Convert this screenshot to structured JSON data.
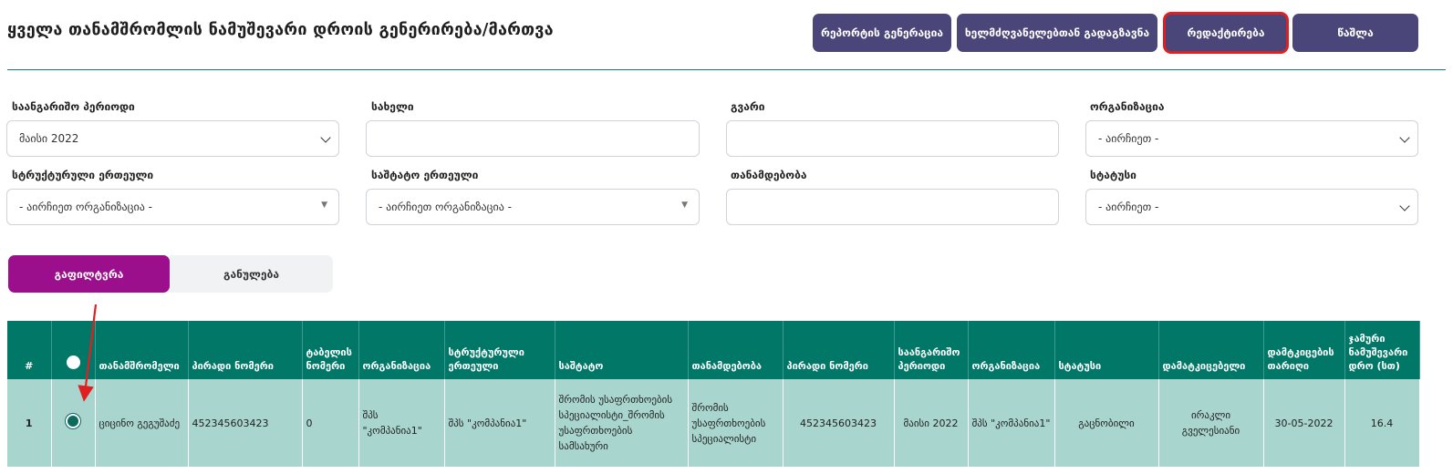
{
  "page": {
    "title": "ყველა თანამშრომლის ნამუშევარი დროის გენერირება/მართვა"
  },
  "toolbar": {
    "report_label": "რეპორტის გენერაცია",
    "send_label": "ხელმძღვანელებთან გადაგზავნა",
    "edit_label": "რედაქტირება",
    "delete_label": "წაშლა"
  },
  "filters": {
    "period_label": "საანგარიშო პერიოდი",
    "period_value": "მაისი 2022",
    "name_label": "სახელი",
    "name_value": "",
    "surname_label": "გვარი",
    "surname_value": "",
    "org_label": "ორგანიზაცია",
    "org_value": "- აირჩიეთ -",
    "struct_label": "სტრუქტურული ერთეული",
    "struct_value": "- აირჩიეთ ორგანიზაცია -",
    "staff_label": "საშტატო ერთეული",
    "staff_value": "- აირჩიეთ ორგანიზაცია -",
    "position_label": "თანამდებობა",
    "position_value": "",
    "status_label": "სტატუსი",
    "status_value": "- აირჩიეთ -"
  },
  "actions": {
    "filter_label": "გაფილტვრა",
    "reset_label": "განულება"
  },
  "table": {
    "headers": {
      "num": "#",
      "employee": "თანამშრომელი",
      "personal_number": "პირადი ნომერი",
      "table_number": "ტაბელის ნომერი",
      "organization": "ორგანიზაცია",
      "structural_unit": "სტრუქტურული ერთეული",
      "staff": "საშტატო",
      "position": "თანამდებობა",
      "personal_number_2": "პირადი ნომერი",
      "period": "საანგარიშო პერიოდი",
      "organization_2": "ორგანიზაცია",
      "status": "სტატუსი",
      "approver": "დამატკიცებელი",
      "approval_date": "დამტკიცების თარიღი",
      "total_hours": "ჯამური ნამუშევარი დრო (სთ)"
    },
    "rows": [
      {
        "num": "1",
        "employee": "ციცინო გეგუშაძე",
        "personal_number": "452345603423",
        "table_number": "0",
        "organization": "შპს \"კომპანია1\"",
        "structural_unit": "შპს \"კომპანია1\"",
        "staff": "შრომის უსაფრთხოების სპეციალისტი_შრომის უსაფრთხოების სამსახური",
        "position": "შრომის უსაფრთხოების სპეციალისტი",
        "personal_number_2": "452345603423",
        "period": "მაისი 2022",
        "organization_2": "შპს \"კომპანია1\"",
        "status": "გაცნობილი",
        "approver": "ირაკლი გველესიანი",
        "approval_date": "30-05-2022",
        "total_hours": "16.4"
      }
    ]
  }
}
